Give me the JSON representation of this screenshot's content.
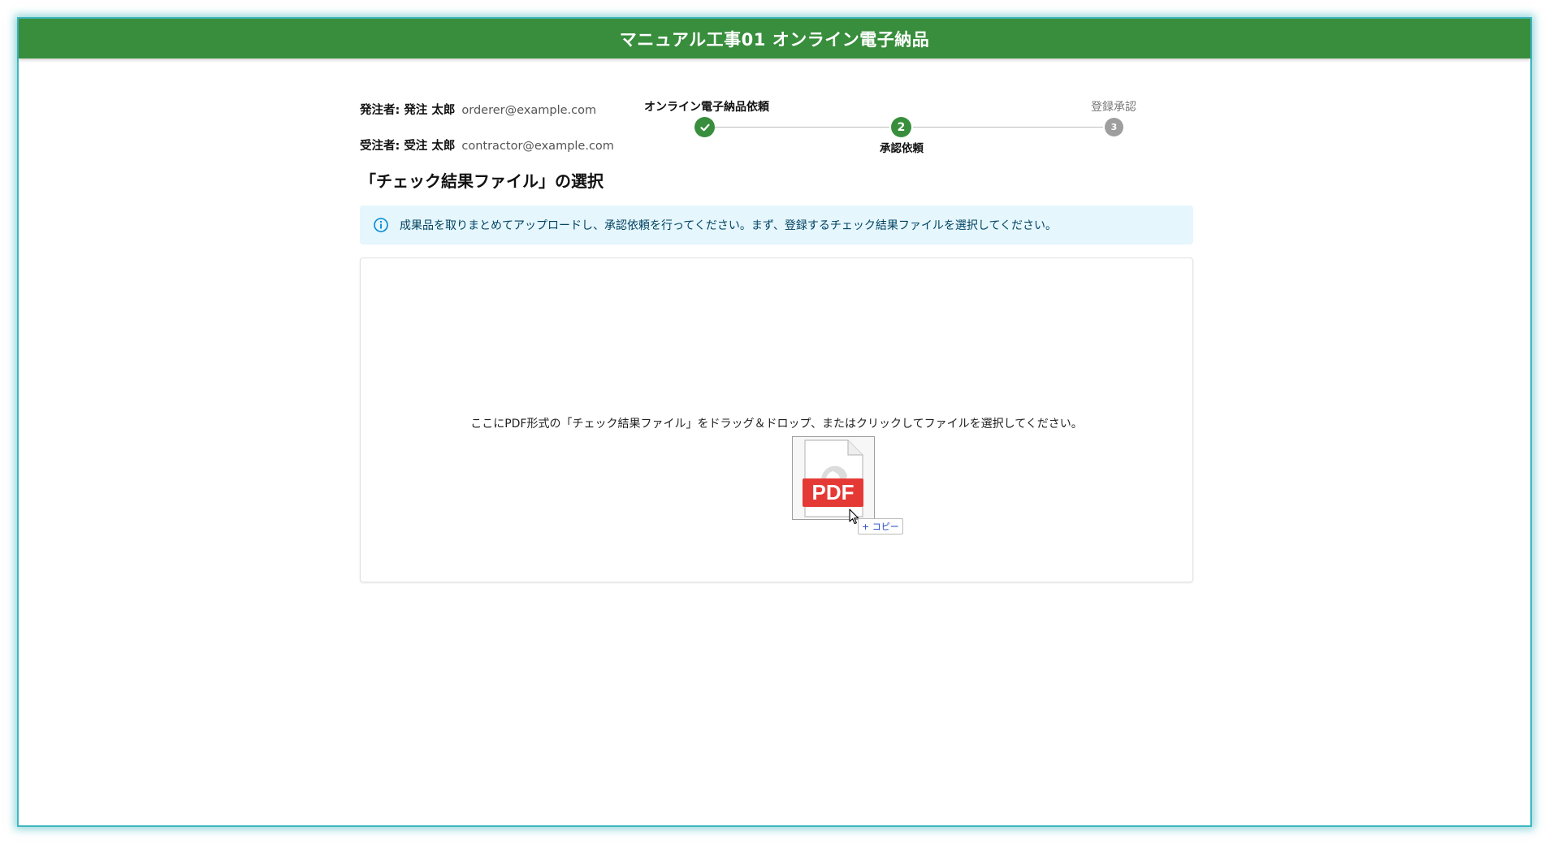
{
  "window": {
    "title": "マニュアル工事01 オンライン電子納品"
  },
  "parties": {
    "orderer": {
      "label": "発注者:",
      "name": "発注 太郎",
      "email": "orderer@example.com"
    },
    "contractor": {
      "label": "受注者:",
      "name": "受注 太郎",
      "email": "contractor@example.com"
    }
  },
  "stepper": {
    "steps": [
      {
        "label": "オンライン電子納品依頼",
        "state": "completed",
        "icon": "check-icon"
      },
      {
        "label": "承認依頼",
        "number": "2",
        "state": "active"
      },
      {
        "label": "登録承認",
        "number": "3",
        "state": "pending"
      }
    ]
  },
  "main": {
    "title": "「チェック結果ファイル」の選択",
    "info": {
      "icon": "info-icon",
      "text": "成果品を取りまとめてアップロードし、承認依頼を行ってください。まず、登録するチェック結果ファイルを選択してください。"
    },
    "dropzone": {
      "instruction": "ここにPDF形式の「チェック結果ファイル」をドラッグ＆ドロップ、またはクリックしてファイルを選択してください。",
      "drag_file_label": "PDF",
      "drag_file_icon": "pdf-file-icon",
      "copy_badge": "+ コピー"
    }
  },
  "colors": {
    "header": "#388e3c",
    "step_active": "#388e3c",
    "step_pending": "#9e9e9e",
    "info_bg": "#e5f6fd",
    "info_text": "#014361",
    "pdf_red": "#e53935",
    "window_border": "#3fb8c0"
  }
}
